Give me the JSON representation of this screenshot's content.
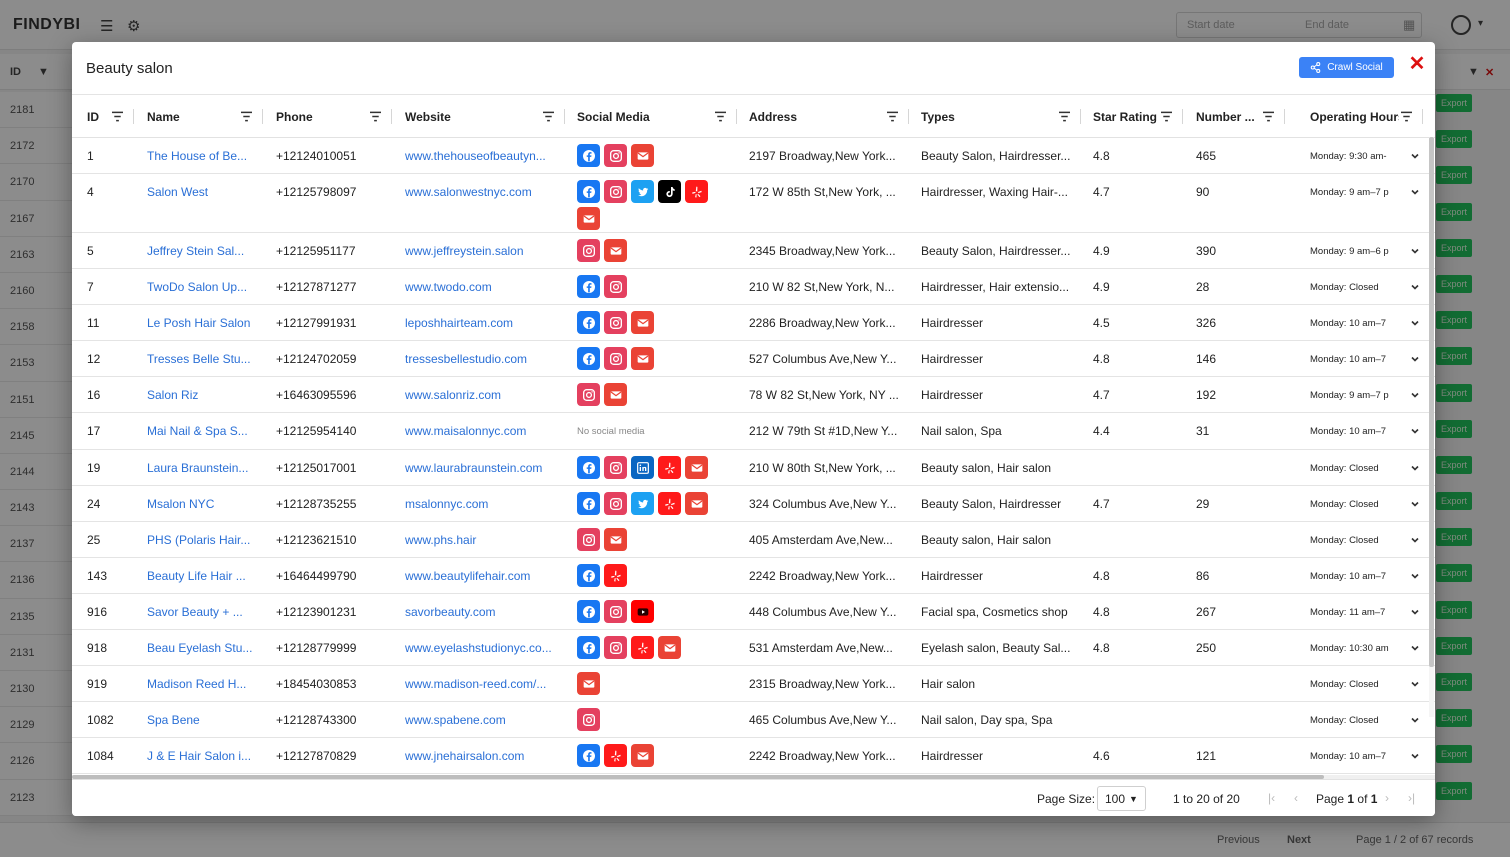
{
  "background": {
    "logo": "FINDYBI",
    "start_date_placeholder": "Start date",
    "end_date_placeholder": "End date",
    "id_header": "ID",
    "ids": [
      "2181",
      "2172",
      "2170",
      "2167",
      "2163",
      "2160",
      "2158",
      "2153",
      "2151",
      "2145",
      "2144",
      "2143",
      "2137",
      "2136",
      "2135",
      "2131",
      "2130",
      "2129",
      "2126",
      "2123"
    ],
    "export_label": "Export",
    "prev_label": "Previous",
    "next_label": "Next",
    "page_records": "Page 1 / 2 of 67 records"
  },
  "modal": {
    "title": "Beauty salon",
    "crawl_button": "Crawl Social",
    "close_symbol": "✕"
  },
  "columns": [
    "ID",
    "Name",
    "Phone",
    "Website",
    "Social Media",
    "Address",
    "Types",
    "Star Rating",
    "Number ...",
    "Operating Hours"
  ],
  "no_social_text": "No social media",
  "rows": [
    {
      "id": "1",
      "name": "The House of Be...",
      "phone": "+12124010051",
      "website": "www.thehouseofbeautyn...",
      "social": [
        "facebook",
        "instagram",
        "email"
      ],
      "address": "2197 Broadway,New York...",
      "types": "Beauty Salon, Hairdresser...",
      "rating": "4.8",
      "number": "465",
      "hours": "Monday: 9:30 am-"
    },
    {
      "id": "4",
      "name": "Salon West",
      "phone": "+12125798097",
      "website": "www.salonwestnyc.com",
      "social": [
        "facebook",
        "instagram",
        "twitter",
        "tiktok",
        "yelp",
        "email"
      ],
      "address": "172 W 85th St,New York, ...",
      "types": "Hairdresser, Waxing Hair-...",
      "rating": "4.7",
      "number": "90",
      "hours": "Monday: 9 am–7 p"
    },
    {
      "id": "5",
      "name": "Jeffrey Stein Sal...",
      "phone": "+12125951177",
      "website": "www.jeffreystein.salon",
      "social": [
        "instagram",
        "email"
      ],
      "address": "2345 Broadway,New York...",
      "types": "Beauty Salon, Hairdresser...",
      "rating": "4.9",
      "number": "390",
      "hours": "Monday: 9 am–6 p"
    },
    {
      "id": "7",
      "name": "TwoDo Salon Up...",
      "phone": "+12127871277",
      "website": "www.twodo.com",
      "social": [
        "facebook",
        "instagram"
      ],
      "address": "210 W 82 St,New York, N...",
      "types": "Hairdresser, Hair extensio...",
      "rating": "4.9",
      "number": "28",
      "hours": "Monday: Closed"
    },
    {
      "id": "11",
      "name": "Le Posh Hair Salon",
      "phone": "+12127991931",
      "website": "leposhhairteam.com",
      "social": [
        "facebook",
        "instagram",
        "email"
      ],
      "address": "2286 Broadway,New York...",
      "types": "Hairdresser",
      "rating": "4.5",
      "number": "326",
      "hours": "Monday: 10 am–7"
    },
    {
      "id": "12",
      "name": "Tresses Belle Stu...",
      "phone": "+12124702059",
      "website": "tressesbellestudio.com",
      "social": [
        "facebook",
        "instagram",
        "email"
      ],
      "address": "527 Columbus Ave,New Y...",
      "types": "Hairdresser",
      "rating": "4.8",
      "number": "146",
      "hours": "Monday: 10 am–7"
    },
    {
      "id": "16",
      "name": "Salon Riz",
      "phone": "+16463095596",
      "website": "www.salonriz.com",
      "social": [
        "instagram",
        "email"
      ],
      "address": "78 W 82 St,New York, NY ...",
      "types": "Hairdresser",
      "rating": "4.7",
      "number": "192",
      "hours": "Monday: 9 am–7 p"
    },
    {
      "id": "17",
      "name": "Mai Nail & Spa S...",
      "phone": "+12125954140",
      "website": "www.maisalonnyc.com",
      "social": [],
      "address": "212 W 79th St #1D,New Y...",
      "types": "Nail salon, Spa",
      "rating": "4.4",
      "number": "31",
      "hours": "Monday: 10 am–7"
    },
    {
      "id": "19",
      "name": "Laura Braunstein...",
      "phone": "+12125017001",
      "website": "www.laurabraunstein.com",
      "social": [
        "facebook",
        "instagram",
        "linkedin",
        "yelp",
        "email"
      ],
      "address": "210 W 80th St,New York, ...",
      "types": "Beauty salon, Hair salon",
      "rating": "",
      "number": "",
      "hours": "Monday: Closed"
    },
    {
      "id": "24",
      "name": "Msalon NYC",
      "phone": "+12128735255",
      "website": "msalonnyc.com",
      "social": [
        "facebook",
        "instagram",
        "twitter",
        "yelp",
        "email"
      ],
      "address": "324 Columbus Ave,New Y...",
      "types": "Beauty Salon, Hairdresser",
      "rating": "4.7",
      "number": "29",
      "hours": "Monday: Closed"
    },
    {
      "id": "25",
      "name": "PHS (Polaris Hair...",
      "phone": "+12123621510",
      "website": "www.phs.hair",
      "social": [
        "instagram",
        "email"
      ],
      "address": "405 Amsterdam Ave,New...",
      "types": "Beauty salon, Hair salon",
      "rating": "",
      "number": "",
      "hours": "Monday: Closed"
    },
    {
      "id": "143",
      "name": "Beauty Life Hair ...",
      "phone": "+16464499790",
      "website": "www.beautylifehair.com",
      "social": [
        "facebook",
        "yelp"
      ],
      "address": "2242 Broadway,New York...",
      "types": "Hairdresser",
      "rating": "4.8",
      "number": "86",
      "hours": "Monday: 10 am–7"
    },
    {
      "id": "916",
      "name": "Savor Beauty + ...",
      "phone": "+12123901231",
      "website": "savorbeauty.com",
      "social": [
        "facebook",
        "instagram",
        "youtube"
      ],
      "address": "448 Columbus Ave,New Y...",
      "types": "Facial spa, Cosmetics shop",
      "rating": "4.8",
      "number": "267",
      "hours": "Monday: 11 am–7"
    },
    {
      "id": "918",
      "name": "Beau Eyelash Stu...",
      "phone": "+12128779999",
      "website": "www.eyelashstudionyc.co...",
      "social": [
        "facebook",
        "instagram",
        "yelp",
        "email"
      ],
      "address": "531 Amsterdam Ave,New...",
      "types": "Eyelash salon, Beauty Sal...",
      "rating": "4.8",
      "number": "250",
      "hours": "Monday: 10:30 am"
    },
    {
      "id": "919",
      "name": "Madison Reed H...",
      "phone": "+18454030853",
      "website": "www.madison-reed.com/...",
      "social": [
        "email"
      ],
      "address": "2315 Broadway,New York...",
      "types": "Hair salon",
      "rating": "",
      "number": "",
      "hours": "Monday: Closed"
    },
    {
      "id": "1082",
      "name": "Spa Bene",
      "phone": "+12128743300",
      "website": "www.spabene.com",
      "social": [
        "instagram"
      ],
      "address": "465 Columbus Ave,New Y...",
      "types": "Nail salon, Day spa, Spa",
      "rating": "",
      "number": "",
      "hours": "Monday: Closed"
    },
    {
      "id": "1084",
      "name": "J & E Hair Salon i...",
      "phone": "+12127870829",
      "website": "www.jnehairsalon.com",
      "social": [
        "facebook",
        "yelp",
        "email"
      ],
      "address": "2242 Broadway,New York...",
      "types": "Hairdresser",
      "rating": "4.6",
      "number": "121",
      "hours": "Monday: 10 am–7"
    }
  ],
  "pagination": {
    "page_size_label": "Page Size:",
    "page_size_value": "100",
    "range_from": "1",
    "range_to_word": "to",
    "range_to": "20",
    "of_word": "of",
    "total": "20",
    "page_word": "Page",
    "page_current": "1",
    "page_of_word": "of",
    "page_total": "1"
  },
  "colors": {
    "accent": "#3b82f6",
    "link": "#2a6fd6",
    "close": "#dd1111",
    "export": "#22c55e",
    "facebook": "#1877f2",
    "instagram": "#e4405f",
    "email": "#ea4335",
    "twitter": "#1da1f2",
    "tiktok": "#000000",
    "yelp": "#ff1a1a",
    "linkedin": "#0a66c2",
    "youtube": "#ff0000"
  }
}
